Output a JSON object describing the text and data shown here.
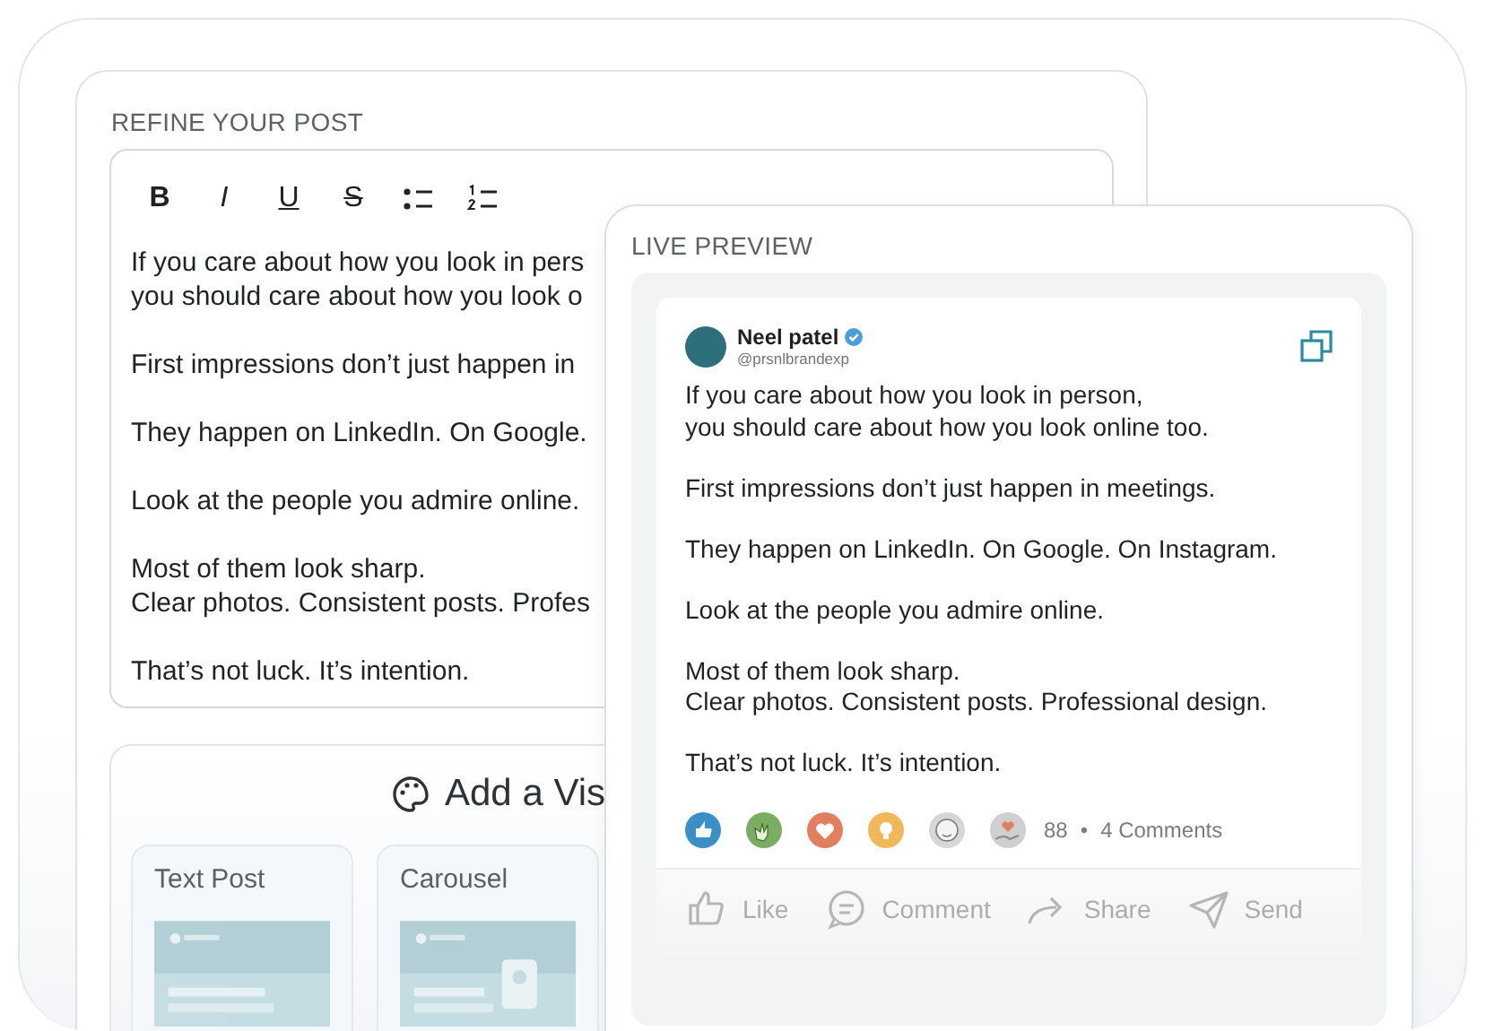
{
  "editor": {
    "title": "REFINE YOUR POST",
    "toolbar": [
      {
        "kind": "bold",
        "label": "B"
      },
      {
        "kind": "italic",
        "label": "I"
      },
      {
        "kind": "underline",
        "label": "U"
      },
      {
        "kind": "strike",
        "label": "S"
      },
      {
        "kind": "bullet-list"
      },
      {
        "kind": "numbered-list"
      }
    ],
    "paragraphs": [
      [
        "If you care about how you look in pers",
        "you should care about how you look o"
      ],
      [
        "First impressions don’t just happen in"
      ],
      [
        "They happen on LinkedIn. On Google."
      ],
      [
        "Look at the people you admire online."
      ],
      [
        "Most of them look sharp.",
        "Clear photos. Consistent posts. Profes"
      ],
      [
        "That’s not luck. It’s intention."
      ]
    ]
  },
  "visual": {
    "heading": "Add a Vis",
    "options": [
      {
        "label": "Text Post",
        "kind": "picture"
      },
      {
        "label": "Carousel",
        "kind": "picture"
      }
    ]
  },
  "preview": {
    "title": "LIVE PREVIEW",
    "author": {
      "name": "Neel patel",
      "handle": "@prsnlbrandexp",
      "verified": true
    },
    "paragraphs": [
      [
        "If you care about how you look in person,",
        "you should care about how you look online too."
      ],
      [
        "First impressions don’t just happen in meetings."
      ],
      [
        "They happen on LinkedIn. On Google. On Instagram."
      ],
      [
        "Look at the people you admire online."
      ],
      [
        "Most of them look sharp.",
        "Clear photos. Consistent posts. Professional design."
      ],
      [
        "That’s not luck. It’s intention."
      ]
    ],
    "reactions": [
      {
        "kind": "like"
      },
      {
        "kind": "clap"
      },
      {
        "kind": "love"
      },
      {
        "kind": "idea"
      },
      {
        "kind": "funny"
      },
      {
        "kind": "support"
      }
    ],
    "reaction_count": "88",
    "separator": "•",
    "comments": "4 Comments",
    "actions": [
      {
        "kind": "like",
        "label": "Like"
      },
      {
        "kind": "comment",
        "label": "Comment"
      },
      {
        "kind": "share",
        "label": "Share"
      },
      {
        "kind": "send",
        "label": "Send"
      }
    ]
  }
}
